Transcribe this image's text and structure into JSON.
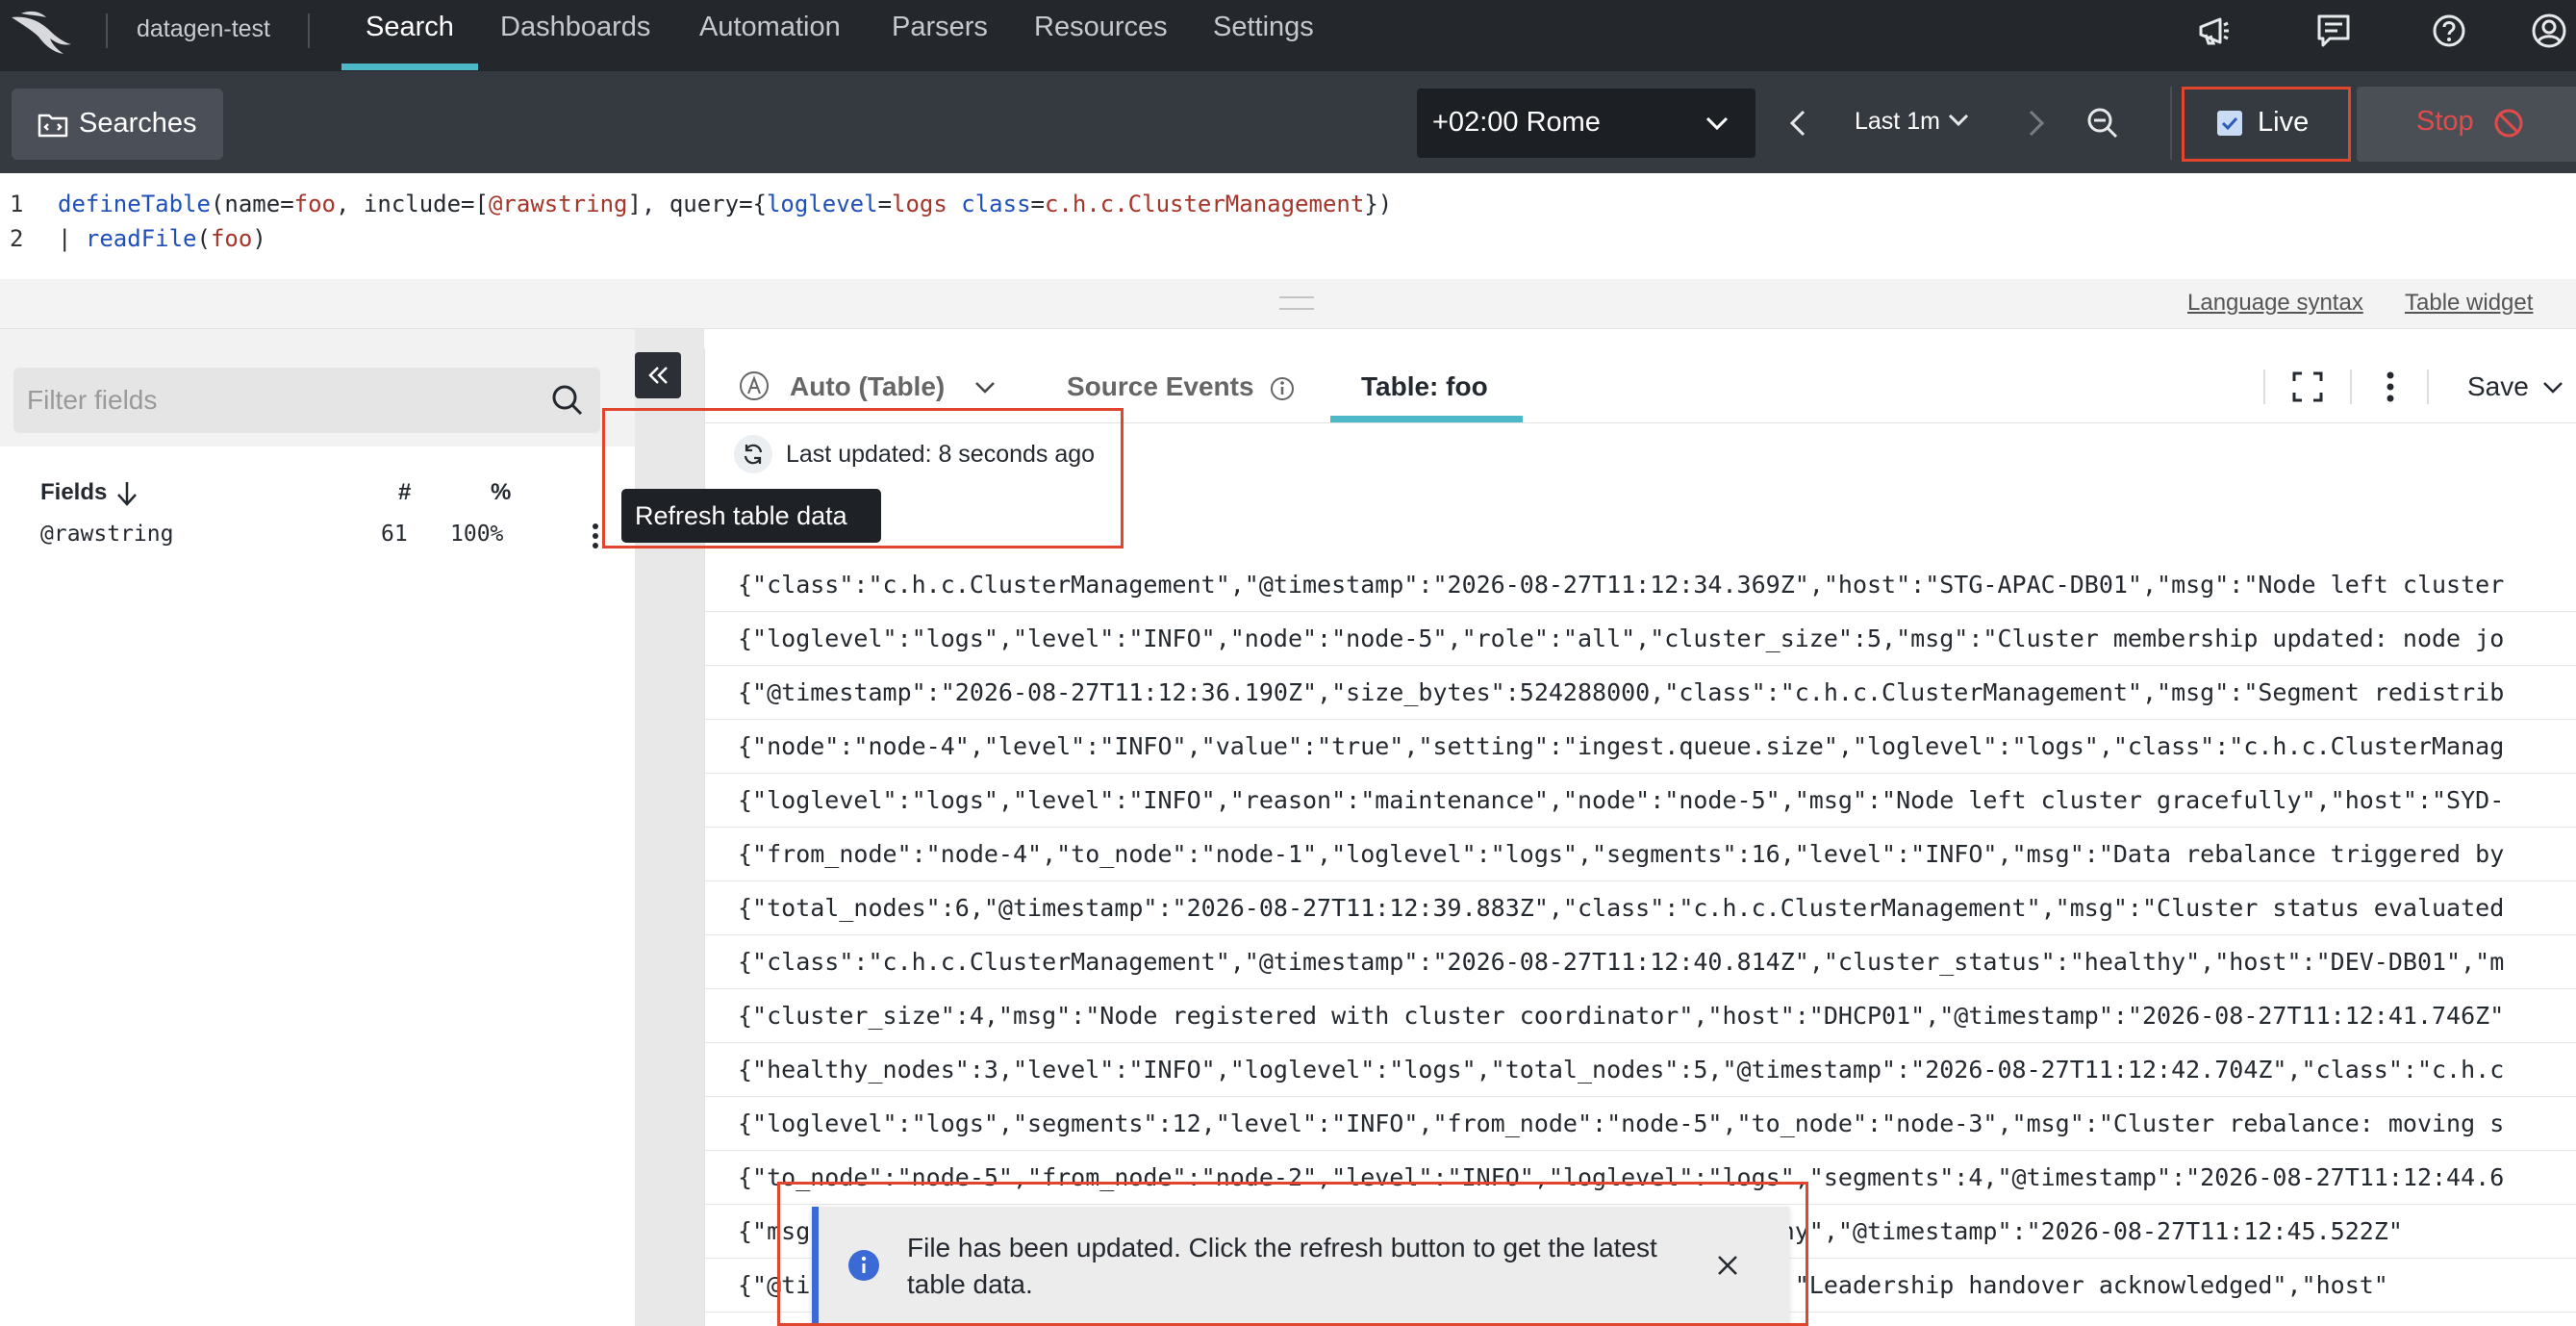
{
  "nav": {
    "repo": "datagen-test",
    "tabs": [
      {
        "label": "Search"
      },
      {
        "label": "Dashboards"
      },
      {
        "label": "Automation"
      },
      {
        "label": "Parsers"
      },
      {
        "label": "Resources"
      },
      {
        "label": "Settings"
      }
    ],
    "icons": [
      "falcon-logo-icon",
      "megaphone-icon",
      "feedback-icon",
      "help-icon",
      "user-icon"
    ]
  },
  "toolbar": {
    "searches_label": "Searches",
    "timezone": "+02:00 Rome",
    "time_range": "Last 1m",
    "live_label": "Live",
    "live_checked": true,
    "stop_label": "Stop"
  },
  "query": {
    "line_numbers": [
      "1",
      "2"
    ],
    "line1": {
      "fn": "defineTable",
      "p1": "(name=",
      "v1": "foo",
      "p2": ", include=[",
      "v2": "@rawstring",
      "p3": "], query={",
      "k3": "loglevel",
      "p4": "=",
      "v3": "logs",
      "p5": " ",
      "k4": "class",
      "p6": "=",
      "v4": "c.h.c.ClusterManagement",
      "p7": "})"
    },
    "line2": {
      "pipe": "| ",
      "fn": "readFile",
      "p1": "(",
      "v1": "foo",
      "p2": ")"
    }
  },
  "links": {
    "language_syntax": "Language syntax",
    "table_widget": "Table widget"
  },
  "sidebar": {
    "filter_placeholder": "Filter fields",
    "headers": {
      "fields": "Fields",
      "count": "#",
      "percent": "%"
    },
    "fields": [
      {
        "name": "@rawstring",
        "count": "61",
        "percent": "100%"
      }
    ]
  },
  "panel": {
    "tabs": {
      "auto": "Auto (Table)",
      "source": "Source Events",
      "table": "Table: foo"
    },
    "save_label": "Save",
    "last_updated": "Last updated: 8 seconds ago",
    "refresh_tooltip": "Refresh table data",
    "rows": [
      "{\"class\":\"c.h.c.ClusterManagement\",\"@timestamp\":\"2026-08-27T11:12:34.369Z\",\"host\":\"STG-APAC-DB01\",\"msg\":\"Node left cluster",
      "{\"loglevel\":\"logs\",\"level\":\"INFO\",\"node\":\"node-5\",\"role\":\"all\",\"cluster_size\":5,\"msg\":\"Cluster membership updated: node jo",
      "{\"@timestamp\":\"2026-08-27T11:12:36.190Z\",\"size_bytes\":524288000,\"class\":\"c.h.c.ClusterManagement\",\"msg\":\"Segment redistrib",
      "{\"node\":\"node-4\",\"level\":\"INFO\",\"value\":\"true\",\"setting\":\"ingest.queue.size\",\"loglevel\":\"logs\",\"class\":\"c.h.c.ClusterManag",
      "{\"loglevel\":\"logs\",\"level\":\"INFO\",\"reason\":\"maintenance\",\"node\":\"node-5\",\"msg\":\"Node left cluster gracefully\",\"host\":\"SYD-",
      "{\"from_node\":\"node-4\",\"to_node\":\"node-1\",\"loglevel\":\"logs\",\"segments\":16,\"level\":\"INFO\",\"msg\":\"Data rebalance triggered by",
      "{\"total_nodes\":6,\"@timestamp\":\"2026-08-27T11:12:39.883Z\",\"class\":\"c.h.c.ClusterManagement\",\"msg\":\"Cluster status evaluated",
      "{\"class\":\"c.h.c.ClusterManagement\",\"@timestamp\":\"2026-08-27T11:12:40.814Z\",\"cluster_status\":\"healthy\",\"host\":\"DEV-DB01\",\"m",
      "{\"cluster_size\":4,\"msg\":\"Node registered with cluster coordinator\",\"host\":\"DHCP01\",\"@timestamp\":\"2026-08-27T11:12:41.746Z\"",
      "{\"healthy_nodes\":3,\"level\":\"INFO\",\"loglevel\":\"logs\",\"total_nodes\":5,\"@timestamp\":\"2026-08-27T11:12:42.704Z\",\"class\":\"c.h.c",
      "{\"loglevel\":\"logs\",\"segments\":12,\"level\":\"INFO\",\"from_node\":\"node-5\",\"to_node\":\"node-3\",\"msg\":\"Cluster rebalance: moving s",
      "{\"to_node\":\"node-5\",\"from_node\":\"node-2\",\"level\":\"INFO\",\"loglevel\":\"logs\",\"segments\":4,\"@timestamp\":\"2026-08-27T11:12:44.6",
      "{\"msg                                                         us\":\"healthy\",\"@timestamp\":\"2026-08-27T11:12:45.522Z\"",
      "{\"@ti                                                         ent\",\"msg\":\"Leadership handover acknowledged\",\"host\""
    ]
  },
  "toast": {
    "message": "File has been updated. Click the refresh button to get the latest table data."
  },
  "colors": {
    "nav_bg": "#24272c",
    "toolbar_bg": "#353a40",
    "accent": "#4db8c7",
    "highlight": "#e0452d",
    "stop": "#e34b4b",
    "info": "#3b6ad6"
  }
}
